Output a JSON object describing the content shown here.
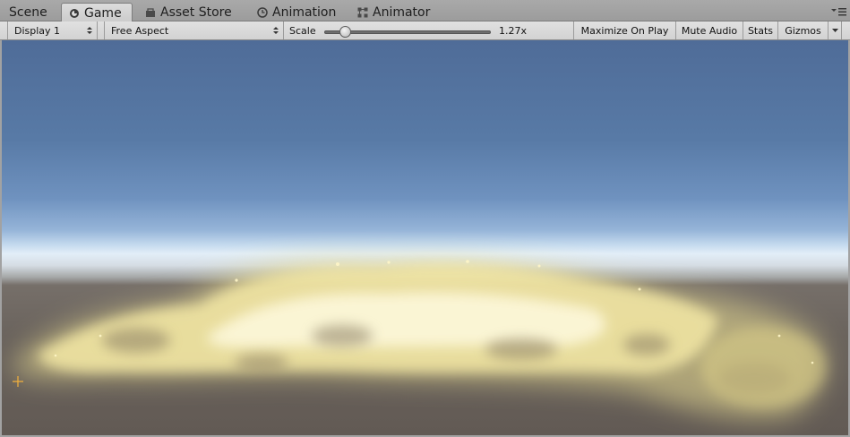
{
  "tabs": [
    {
      "label": "Scene",
      "icon": "scene-icon",
      "active": false
    },
    {
      "label": "Game",
      "icon": "game-icon",
      "active": true
    },
    {
      "label": "Asset Store",
      "icon": "asset-store-icon",
      "active": false
    },
    {
      "label": "Animation",
      "icon": "animation-clock-icon",
      "active": false
    },
    {
      "label": "Animator",
      "icon": "animator-icon",
      "active": false
    }
  ],
  "toolbar": {
    "display": "Display 1",
    "aspect": "Free Aspect",
    "scale_label": "Scale",
    "scale_value_text": "1.27x",
    "scale_fraction": 0.1,
    "maximize": "Maximize On Play",
    "mute": "Mute Audio",
    "stats": "Stats",
    "gizmos": "Gizmos"
  },
  "colors": {
    "sky_top": "#4f6c98",
    "horizon": "#e2eef8",
    "ground": "#6a635d",
    "particles": "#f5e9a0"
  }
}
